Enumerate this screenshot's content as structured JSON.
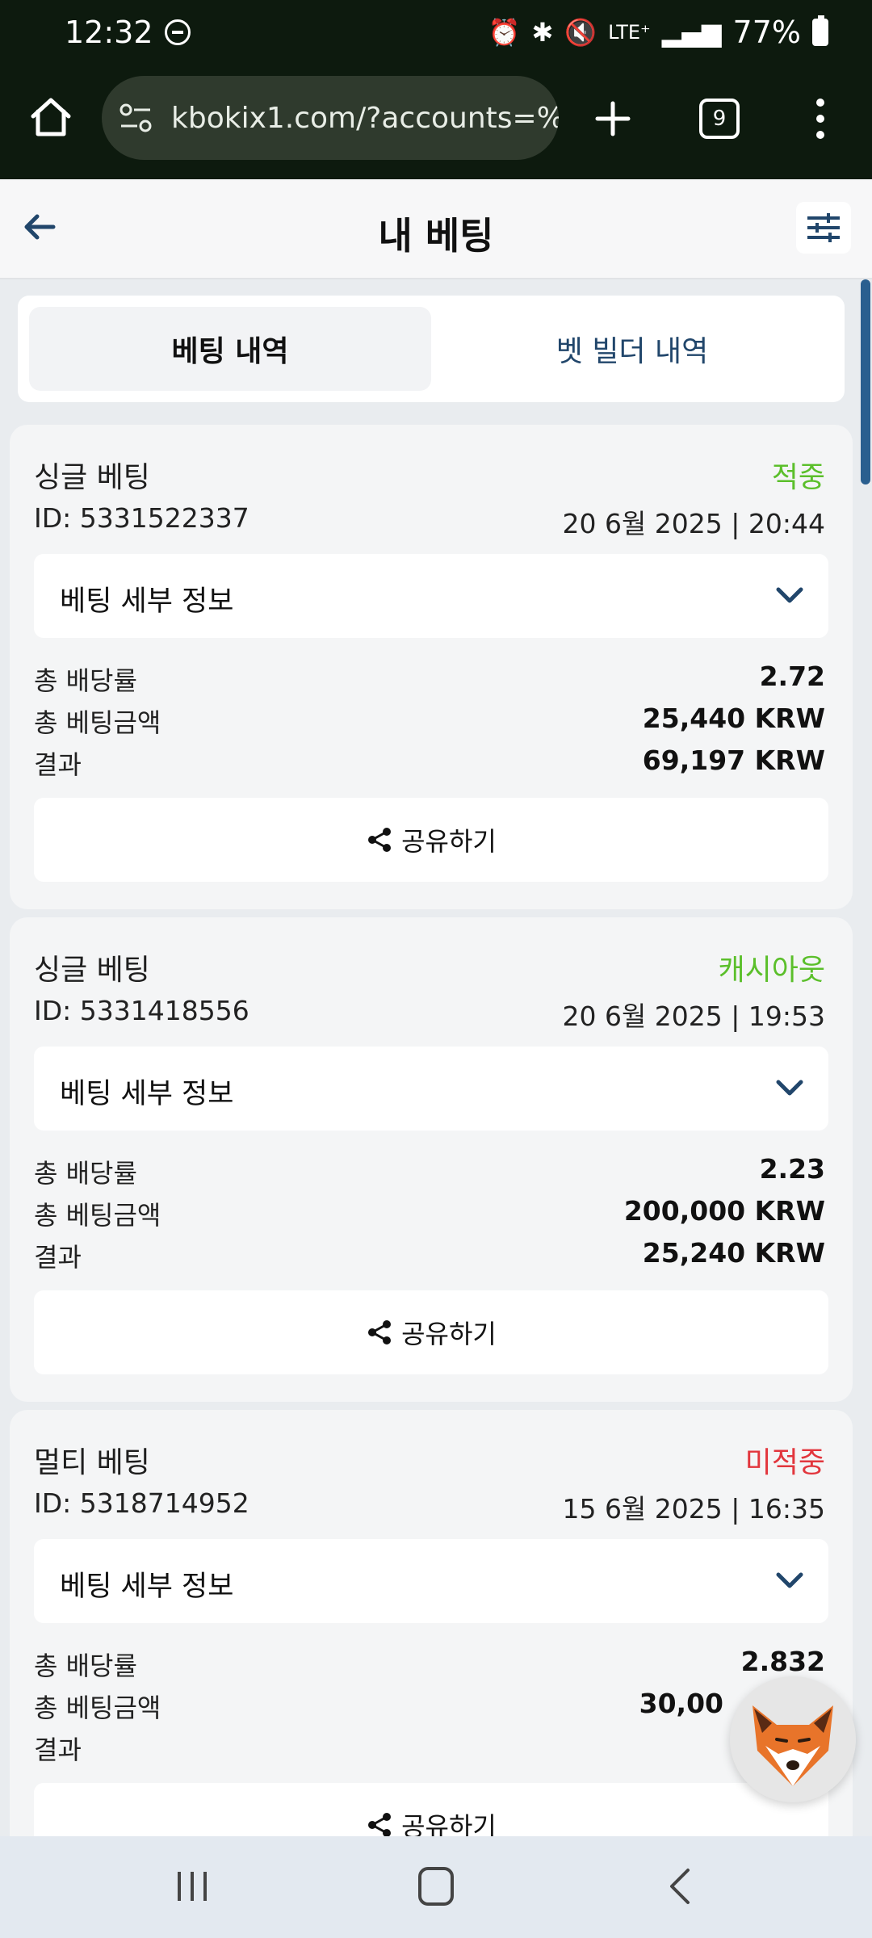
{
  "status_bar": {
    "time": "12:32",
    "indicators": "LTE⁺",
    "battery": "77%",
    "icons": [
      "do-not-disturb-icon",
      "alarm-icon",
      "bluetooth-icon",
      "mute-icon",
      "lte-icon",
      "signal-icon",
      "battery-icon"
    ]
  },
  "browser": {
    "url": "kbokix1.com/?accounts=%2",
    "tab_count": "9"
  },
  "header": {
    "title": "내 베팅"
  },
  "tabs": [
    {
      "label": "베팅 내역"
    },
    {
      "label": "벳 빌더 내역"
    }
  ],
  "labels": {
    "details": "베팅 세부 정보",
    "total_odds": "총 배당률",
    "total_stake": "총 베팅금액",
    "result": "결과",
    "share": "공유하기"
  },
  "bets": [
    {
      "type": "싱글 베팅",
      "status": "적중",
      "status_color": "#5bbf2b",
      "id": "ID: 5331522337",
      "date": "20 6월 2025 | 20:44",
      "odds": "2.72",
      "stake": "25,440 KRW",
      "result": "69,197 KRW"
    },
    {
      "type": "싱글 베팅",
      "status": "캐시아웃",
      "status_color": "#5bbf2b",
      "id": "ID: 5331418556",
      "date": "20 6월 2025 | 19:53",
      "odds": "2.23",
      "stake": "200,000 KRW",
      "result": "25,240 KRW"
    },
    {
      "type": "멀티 베팅",
      "status": "미적중",
      "status_color": "#e2363d",
      "id": "ID: 5318714952",
      "date": "15 6월 2025 | 16:35",
      "odds": "2.832",
      "stake": "30,00",
      "result": ""
    }
  ],
  "colors": {
    "win": "#5bbf2b",
    "lose": "#e2363d",
    "accent": "#21466b"
  }
}
